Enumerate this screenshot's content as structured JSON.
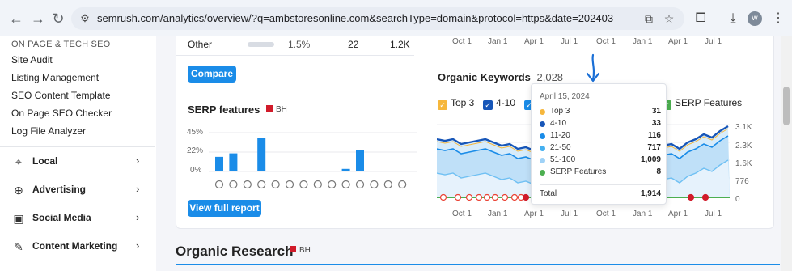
{
  "browser": {
    "url": "semrush.com/analytics/overview/?q=ambstoresonline.com&searchType=domain&protocol=https&date=202403",
    "avatar_letter": "w"
  },
  "sidebar": {
    "section_header": "ON PAGE & TECH SEO",
    "links": [
      "Site Audit",
      "Listing Management",
      "SEO Content Template",
      "On Page SEO Checker",
      "Log File Analyzer"
    ],
    "sections": [
      {
        "label": "Local",
        "icon": "map-pin-icon"
      },
      {
        "label": "Advertising",
        "icon": "crosshair-icon"
      },
      {
        "label": "Social Media",
        "icon": "chat-icon"
      },
      {
        "label": "Content Marketing",
        "icon": "edit-icon"
      }
    ]
  },
  "competitors_row": {
    "name": "Other",
    "percent": "1.5%",
    "count": "22",
    "traffic": "1.2K"
  },
  "compare_button": "Compare",
  "serp_features": {
    "title": "SERP features",
    "badge": "BH",
    "y_ticks": [
      "45%",
      "22%",
      "0%"
    ],
    "view_report_button": "View full report",
    "feature_icons": [
      "featured-snippet-icon",
      "link-icon",
      "star-icon",
      "image-icon",
      "video-icon",
      "video-carousel-icon",
      "video-preview-icon",
      "faq-icon",
      "local-pack-icon",
      "knowledge-panel-icon",
      "reviews-icon",
      "news-icon",
      "shopping-icon",
      "twitter-icon"
    ],
    "chart_data": {
      "type": "bar",
      "categories": [
        "featured snippet",
        "sitelinks",
        "reviews",
        "images",
        "video",
        "video carousel",
        "featured video",
        "people also ask",
        "local pack",
        "knowledge panel",
        "academic",
        "related",
        "shopping",
        "twitter"
      ],
      "series": [
        {
          "name": "BH",
          "color": "#1a8ce8",
          "values": [
            17,
            21,
            0,
            39,
            0,
            0,
            0,
            0,
            0,
            3,
            25,
            0,
            0,
            0
          ]
        },
        {
          "name": "",
          "color": "#d8dce3",
          "values": [
            0,
            0,
            0,
            0,
            0,
            0,
            0,
            0,
            0,
            0,
            0,
            0,
            0,
            0
          ]
        }
      ],
      "ylim": [
        0,
        45
      ],
      "y_tick_labels": [
        "45%",
        "22%",
        "0%"
      ]
    }
  },
  "organic_keywords": {
    "title": "Organic Keywords",
    "total": "2,028",
    "legend": [
      {
        "label": "Top 3",
        "color": "#f6b73c"
      },
      {
        "label": "4-10",
        "color": "#1756b8"
      },
      {
        "label": "11-20",
        "color": "#1a8ce8"
      },
      {
        "label": "SERP Features",
        "color": "#4caf50"
      }
    ],
    "x_top_ticks": [
      "Oct 1",
      "Jan 1",
      "Apr 1",
      "Jul 1",
      "Oct 1",
      "Jan 1",
      "Apr 1",
      "Jul 1"
    ],
    "x_bottom_ticks": [
      "Oct 1",
      "Jan 1",
      "Apr 1",
      "Jul 1",
      "Oct 1",
      "Jan 1",
      "Apr 1",
      "Jul 1"
    ],
    "y_ticks": [
      "3.1K",
      "2.3K",
      "1.6K",
      "776",
      "0"
    ],
    "tooltip": {
      "date": "April 15, 2024",
      "rows": [
        {
          "name": "Top 3",
          "value": "31",
          "color": "#f6b73c"
        },
        {
          "name": "4-10",
          "value": "33",
          "color": "#1756b8"
        },
        {
          "name": "11-20",
          "value": "116",
          "color": "#1a8ce8"
        },
        {
          "name": "21-50",
          "value": "717",
          "color": "#45b0f0"
        },
        {
          "name": "51-100",
          "value": "1,009",
          "color": "#9fd2f7"
        },
        {
          "name": "SERP Features",
          "value": "8",
          "color": "#4caf50"
        }
      ],
      "total_label": "Total",
      "total_value": "1,914"
    }
  },
  "organic_research": {
    "title": "Organic Research",
    "badge": "BH"
  }
}
